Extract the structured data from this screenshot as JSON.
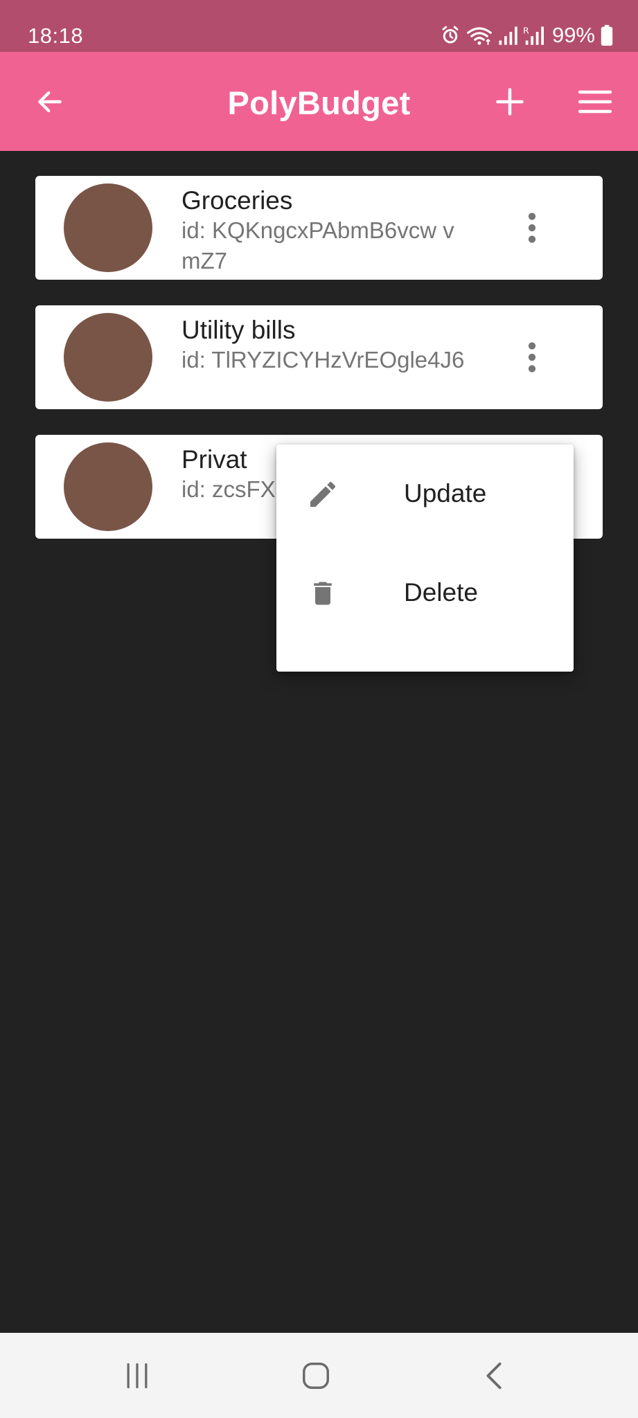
{
  "status_bar": {
    "time": "18:18",
    "battery": "99%",
    "icons": [
      "alarm-icon",
      "wifi-icon",
      "signal-icon",
      "signal-r-icon",
      "battery-icon"
    ]
  },
  "app_bar": {
    "title": "PolyBudget",
    "back_icon": "arrow-left-icon",
    "add_icon": "plus-icon",
    "menu_icon": "hamburger-icon",
    "color": "#f06292"
  },
  "budgets": [
    {
      "name": "Groceries",
      "id_text": "id: KQKngcxPAbmB6vcw vmZ7"
    },
    {
      "name": "Utility bills",
      "id_text": "id: TlRYZICYHzVrEOgle4J6"
    },
    {
      "name": "Privat",
      "id_text": "id: zcsFX3P"
    }
  ],
  "avatar_color": "#795548",
  "context_menu": {
    "items": [
      {
        "label": "Update",
        "icon": "pencil-icon"
      },
      {
        "label": "Delete",
        "icon": "trash-icon"
      }
    ]
  },
  "nav_bar": {
    "icons": [
      "recents-icon",
      "home-icon",
      "back-icon"
    ]
  },
  "colors": {
    "status_bar": "#b24d6d",
    "background": "#222222",
    "card": "#ffffff"
  }
}
